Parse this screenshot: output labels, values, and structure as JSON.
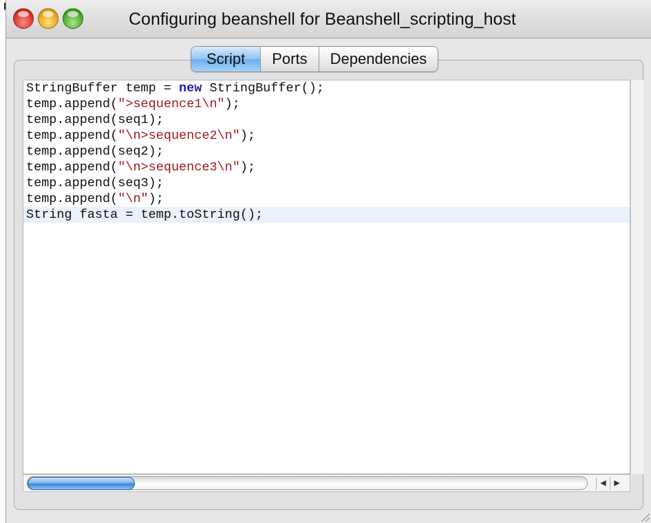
{
  "window": {
    "title": "Configuring beanshell for Beanshell_scripting_host"
  },
  "tabs": [
    {
      "label": "Script",
      "active": true
    },
    {
      "label": "Ports",
      "active": false
    },
    {
      "label": "Dependencies",
      "active": false
    }
  ],
  "editor": {
    "lines": [
      [
        {
          "t": "StringBuffer temp = ",
          "c": "plain"
        },
        {
          "t": "new",
          "c": "kw"
        },
        {
          "t": " StringBuffer();",
          "c": "plain"
        }
      ],
      [
        {
          "t": "temp.append(",
          "c": "plain"
        },
        {
          "t": "\">sequence1\\n\"",
          "c": "str"
        },
        {
          "t": ");",
          "c": "plain"
        }
      ],
      [
        {
          "t": "temp.append(seq1);",
          "c": "plain"
        }
      ],
      [
        {
          "t": "temp.append(",
          "c": "plain"
        },
        {
          "t": "\"\\n>sequence2\\n\"",
          "c": "str"
        },
        {
          "t": ");",
          "c": "plain"
        }
      ],
      [
        {
          "t": "temp.append(seq2);",
          "c": "plain"
        }
      ],
      [
        {
          "t": "temp.append(",
          "c": "plain"
        },
        {
          "t": "\"\\n>sequence3\\n\"",
          "c": "str"
        },
        {
          "t": ");",
          "c": "plain"
        }
      ],
      [
        {
          "t": "temp.append(seq3);",
          "c": "plain"
        }
      ],
      [
        {
          "t": "temp.append(",
          "c": "plain"
        },
        {
          "t": "\"\\n\"",
          "c": "str"
        },
        {
          "t": ");",
          "c": "plain"
        }
      ],
      [
        {
          "t": "String fasta = temp.toString();",
          "c": "plain"
        }
      ]
    ],
    "current_line": 9
  },
  "scrollbar": {
    "left_arrow": "◀",
    "right_arrow": "▶"
  },
  "colors": {
    "keyword": "#1c1ca0",
    "string": "#a3171a",
    "selection_tab": "#6aaeeb"
  }
}
